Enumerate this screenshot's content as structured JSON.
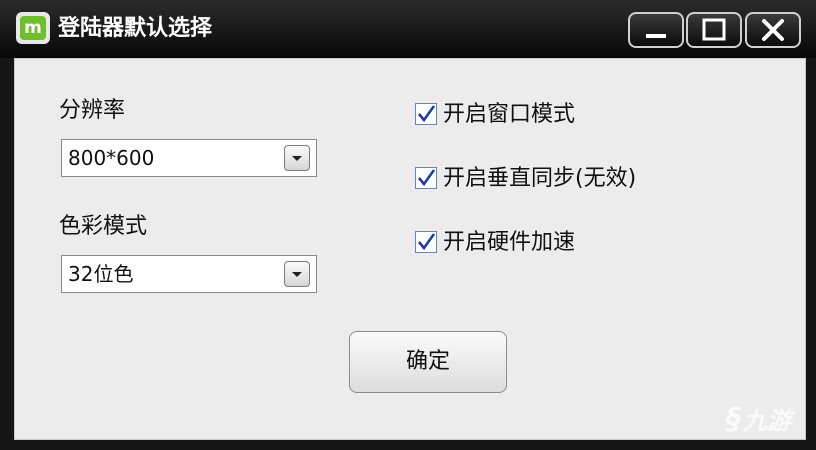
{
  "window": {
    "title": "登陆器默认选择",
    "logo_text": "m"
  },
  "resolution": {
    "label": "分辨率",
    "selected": "800*600"
  },
  "color_mode": {
    "label": "色彩模式",
    "selected": "32位色"
  },
  "options": [
    {
      "label": "开启窗口模式",
      "checked": true
    },
    {
      "label": "开启垂直同步(无效)",
      "checked": true
    },
    {
      "label": "开启硬件加速",
      "checked": true
    }
  ],
  "ok_button": {
    "label": "确定"
  },
  "watermark": {
    "text": "九游"
  },
  "colors": {
    "titlebar": "#0a0a0a",
    "client_bg": "#ececec",
    "logo_green": "#6fbf2a",
    "check_blue": "#1a3fa6"
  },
  "icons": {
    "minimize": "minimize-icon",
    "maximize": "maximize-icon",
    "close": "close-icon",
    "dropdown": "chevron-down-icon",
    "check": "check-icon"
  }
}
